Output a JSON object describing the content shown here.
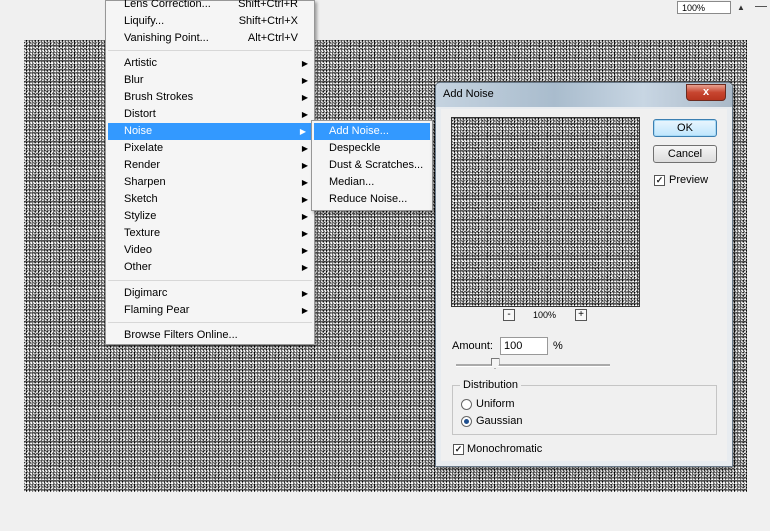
{
  "zoom_readout": "100%",
  "filter_menu": {
    "items": [
      {
        "label": "Lens Correction...",
        "shortcut": "Shift+Ctrl+R"
      },
      {
        "label": "Liquify...",
        "shortcut": "Shift+Ctrl+X"
      },
      {
        "label": "Vanishing Point...",
        "shortcut": "Alt+Ctrl+V"
      },
      {
        "label": "Artistic"
      },
      {
        "label": "Blur"
      },
      {
        "label": "Brush Strokes"
      },
      {
        "label": "Distort"
      },
      {
        "label": "Noise"
      },
      {
        "label": "Pixelate"
      },
      {
        "label": "Render"
      },
      {
        "label": "Sharpen"
      },
      {
        "label": "Sketch"
      },
      {
        "label": "Stylize"
      },
      {
        "label": "Texture"
      },
      {
        "label": "Video"
      },
      {
        "label": "Other"
      },
      {
        "label": "Digimarc"
      },
      {
        "label": "Flaming Pear"
      },
      {
        "label": "Browse Filters Online..."
      }
    ],
    "active_item": "Noise"
  },
  "noise_submenu": {
    "items": [
      "Add Noise...",
      "Despeckle",
      "Dust & Scratches...",
      "Median...",
      "Reduce Noise..."
    ],
    "active_item": "Add Noise..."
  },
  "dialog": {
    "title": "Add Noise",
    "close_glyph": "x",
    "ok_label": "OK",
    "cancel_label": "Cancel",
    "preview_label": "Preview",
    "preview_checked": true,
    "zoom_out": "-",
    "zoom_in": "+",
    "zoom_level": "100%",
    "amount_label": "Amount:",
    "amount_value": "100",
    "amount_unit": "%",
    "amount_slider_fraction": 0.25,
    "distribution_label": "Distribution",
    "uniform_label": "Uniform",
    "gaussian_label": "Gaussian",
    "selected_distribution": "Gaussian",
    "monochromatic_label": "Monochromatic",
    "monochromatic_checked": true,
    "check_glyph": "✓"
  },
  "colors": {
    "menu_highlight": "#3399ff",
    "close_button": "#c7452f"
  }
}
